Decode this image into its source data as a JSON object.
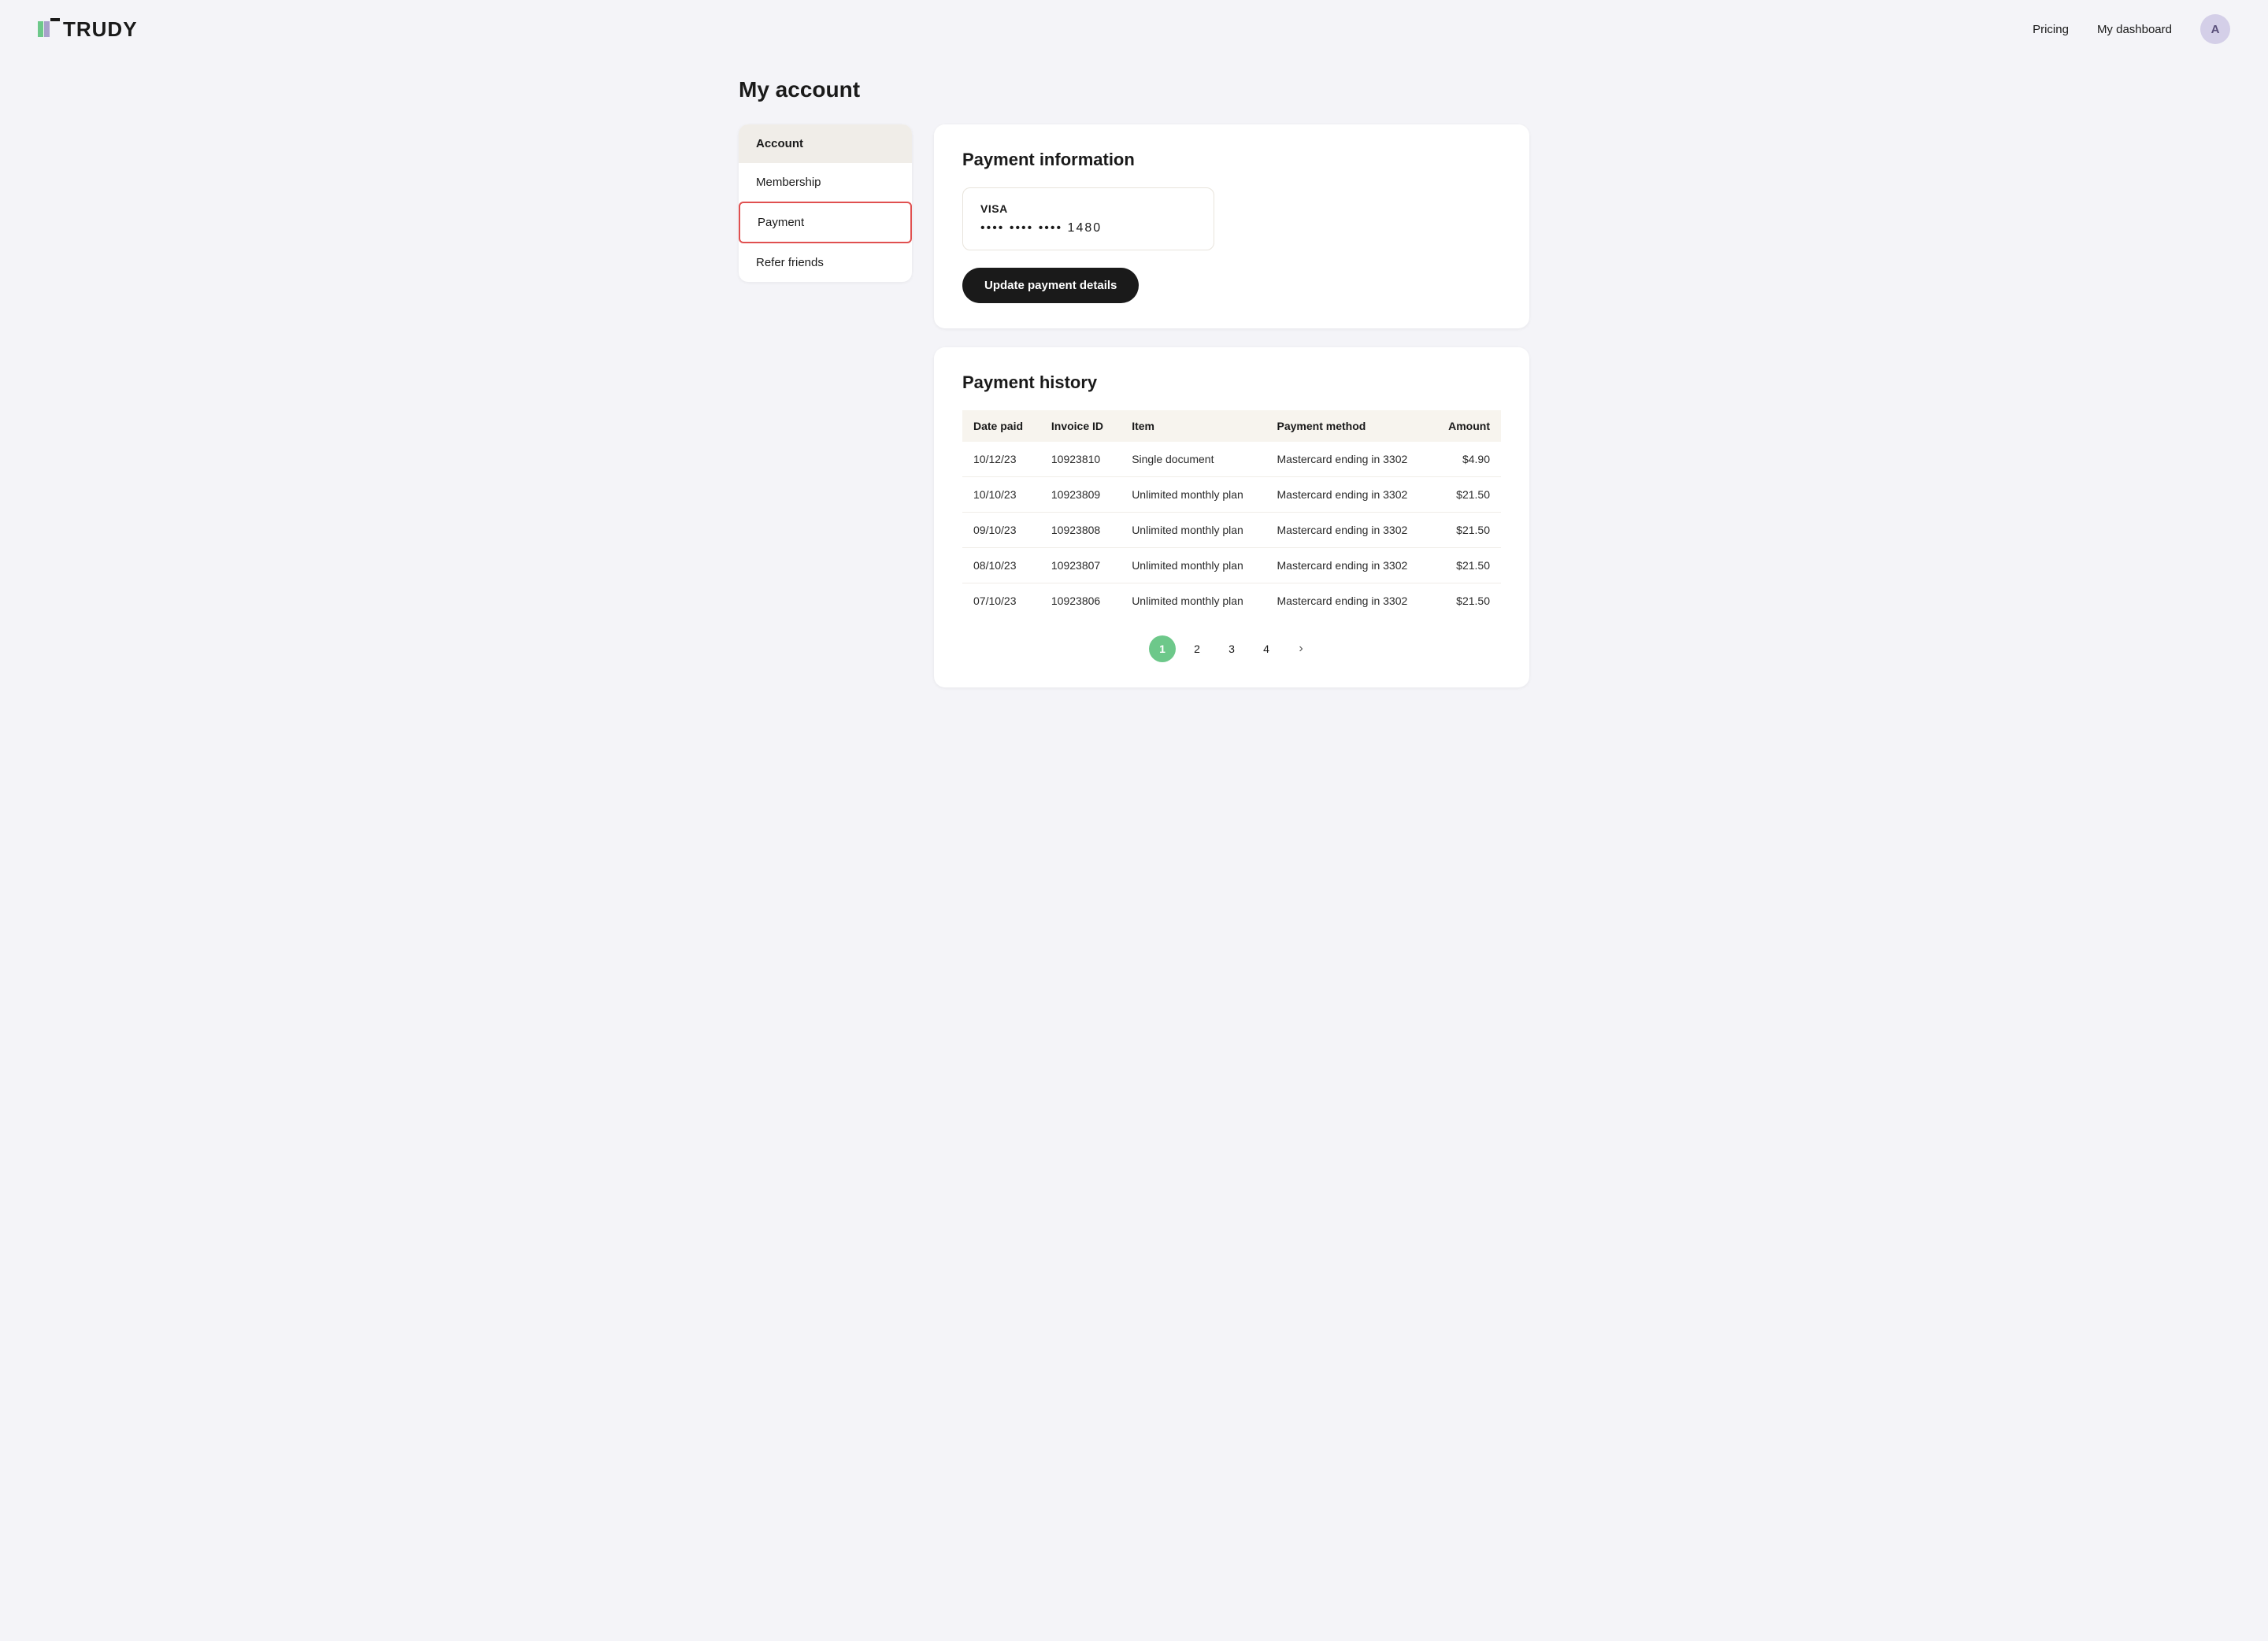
{
  "header": {
    "logo_text": "TRUDY",
    "nav_pricing": "Pricing",
    "nav_dashboard": "My dashboard",
    "avatar_label": "A"
  },
  "page": {
    "title": "My account"
  },
  "sidebar": {
    "items": [
      {
        "id": "account",
        "label": "Account",
        "active": true,
        "selected": false
      },
      {
        "id": "membership",
        "label": "Membership",
        "active": false,
        "selected": false
      },
      {
        "id": "payment",
        "label": "Payment",
        "active": false,
        "selected": true
      },
      {
        "id": "refer-friends",
        "label": "Refer friends",
        "active": false,
        "selected": false
      }
    ]
  },
  "payment_info": {
    "section_title": "Payment information",
    "card_brand": "VISA",
    "card_number_masked": "•••• •••• •••• 1480",
    "update_button_label": "Update payment details"
  },
  "payment_history": {
    "section_title": "Payment history",
    "columns": [
      "Date paid",
      "Invoice ID",
      "Item",
      "Payment method",
      "Amount"
    ],
    "rows": [
      {
        "date": "10/12/23",
        "invoice": "10923810",
        "item": "Single document",
        "method": "Mastercard ending in 3302",
        "amount": "$4.90"
      },
      {
        "date": "10/10/23",
        "invoice": "10923809",
        "item": "Unlimited monthly plan",
        "method": "Mastercard ending in 3302",
        "amount": "$21.50"
      },
      {
        "date": "09/10/23",
        "invoice": "10923808",
        "item": "Unlimited monthly plan",
        "method": "Mastercard ending in 3302",
        "amount": "$21.50"
      },
      {
        "date": "08/10/23",
        "invoice": "10923807",
        "item": "Unlimited monthly plan",
        "method": "Mastercard ending in 3302",
        "amount": "$21.50"
      },
      {
        "date": "07/10/23",
        "invoice": "10923806",
        "item": "Unlimited monthly plan",
        "method": "Mastercard ending in 3302",
        "amount": "$21.50"
      }
    ],
    "pagination": {
      "current": 1,
      "pages": [
        "1",
        "2",
        "3",
        "4"
      ],
      "next_label": "›"
    }
  }
}
